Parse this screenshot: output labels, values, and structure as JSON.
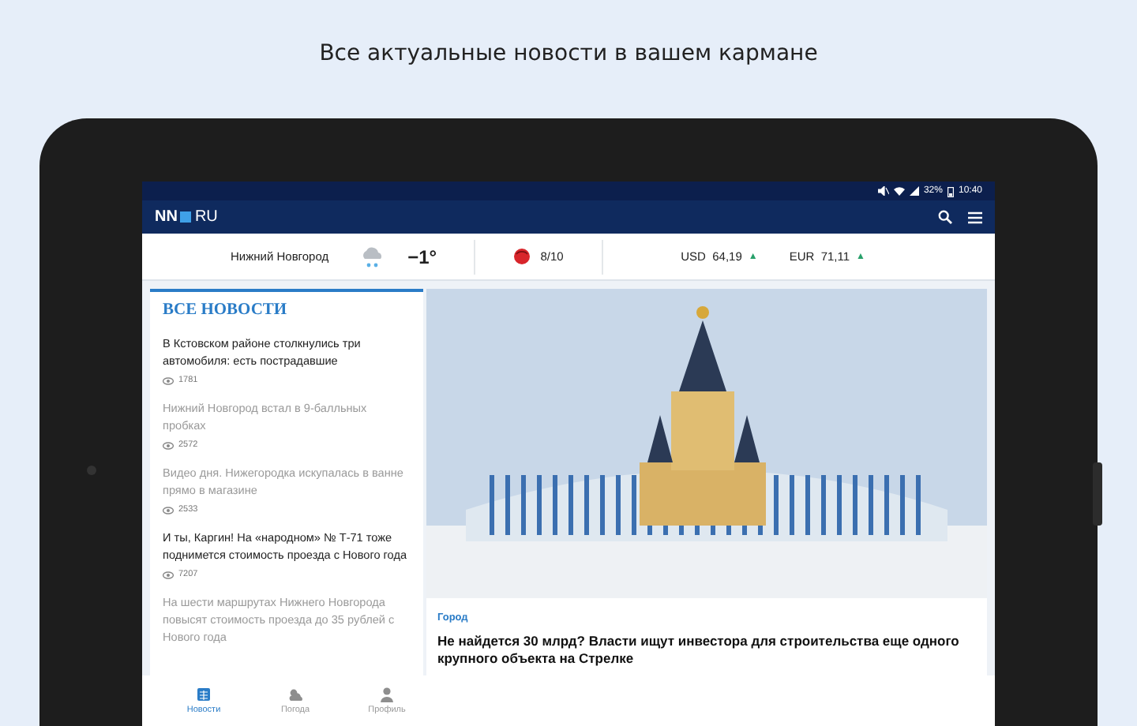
{
  "headline": "Все актуальные новости в вашем кармане",
  "status_bar": {
    "battery": "32%",
    "time": "10:40"
  },
  "app_bar": {
    "logo_left": "NN",
    "logo_right": "RU"
  },
  "info_bar": {
    "city": "Нижний Новгород",
    "temperature": "−1°",
    "traffic": "8/10",
    "rates": [
      {
        "currency": "USD",
        "value": "64,19",
        "arrow": "▲"
      },
      {
        "currency": "EUR",
        "value": "71,11",
        "arrow": "▲"
      }
    ]
  },
  "news_list": {
    "title": "ВСЕ НОВОСТИ",
    "items": [
      {
        "title": "В Кстовском районе столкнулись три автомобиля: есть пострадавшие",
        "views": "1781",
        "read": false
      },
      {
        "title": "Нижний Новгород встал в 9-балльных пробках",
        "views": "2572",
        "read": true
      },
      {
        "title": "Видео дня. Нижегородка искупалась в ванне прямо в магазине",
        "views": "2533",
        "read": true
      },
      {
        "title": "И ты, Каргин! На «народном» № Т-71 тоже поднимется стоимость проезда с Нового года",
        "views": "7207",
        "read": false
      },
      {
        "title": "На шести маршрутах Нижнего Новгорода повысят стоимость проезда до 35 рублей с Нового года",
        "read": true
      }
    ]
  },
  "featured": {
    "category": "Город",
    "title": "Не найдется 30 млрд? Власти ищут инвестора для строительства еще одного крупного объекта на Стрелке"
  },
  "bottom_nav": [
    {
      "kind": "news",
      "label": "Новости",
      "selected": true
    },
    {
      "kind": "weather",
      "label": "Погода",
      "selected": false
    },
    {
      "kind": "profile",
      "label": "Профиль",
      "selected": false
    }
  ]
}
